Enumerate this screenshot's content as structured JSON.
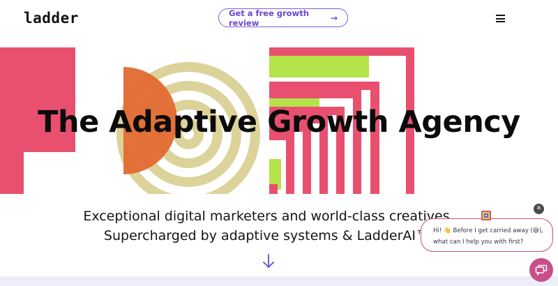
{
  "header": {
    "logo": "ladder",
    "cta_label": "Get a free growth review",
    "cta_arrow": "→",
    "menu_icon": "hamburger-menu-icon"
  },
  "hero": {
    "title": "The Adaptive Growth Agency",
    "subtitle_line1": "Exceptional digital marketers and world-class creatives.",
    "subtitle_line2": "Supercharged by adaptive systems & LadderAI™.",
    "scroll_icon": "arrow-down-icon"
  },
  "chat": {
    "close_label": "✕",
    "message_line1": "Hi! 👋 Before I get carried away (😅),",
    "message_line2": "what can I help you with first?",
    "launcher_icon": "chat-icon"
  },
  "colors": {
    "accent_purple": "#6a45d1",
    "pink": "#e9506f",
    "orange": "#e2692f",
    "lime": "#b4e44a",
    "beige": "#dcd39a",
    "chat_pink": "#c94e8a"
  }
}
